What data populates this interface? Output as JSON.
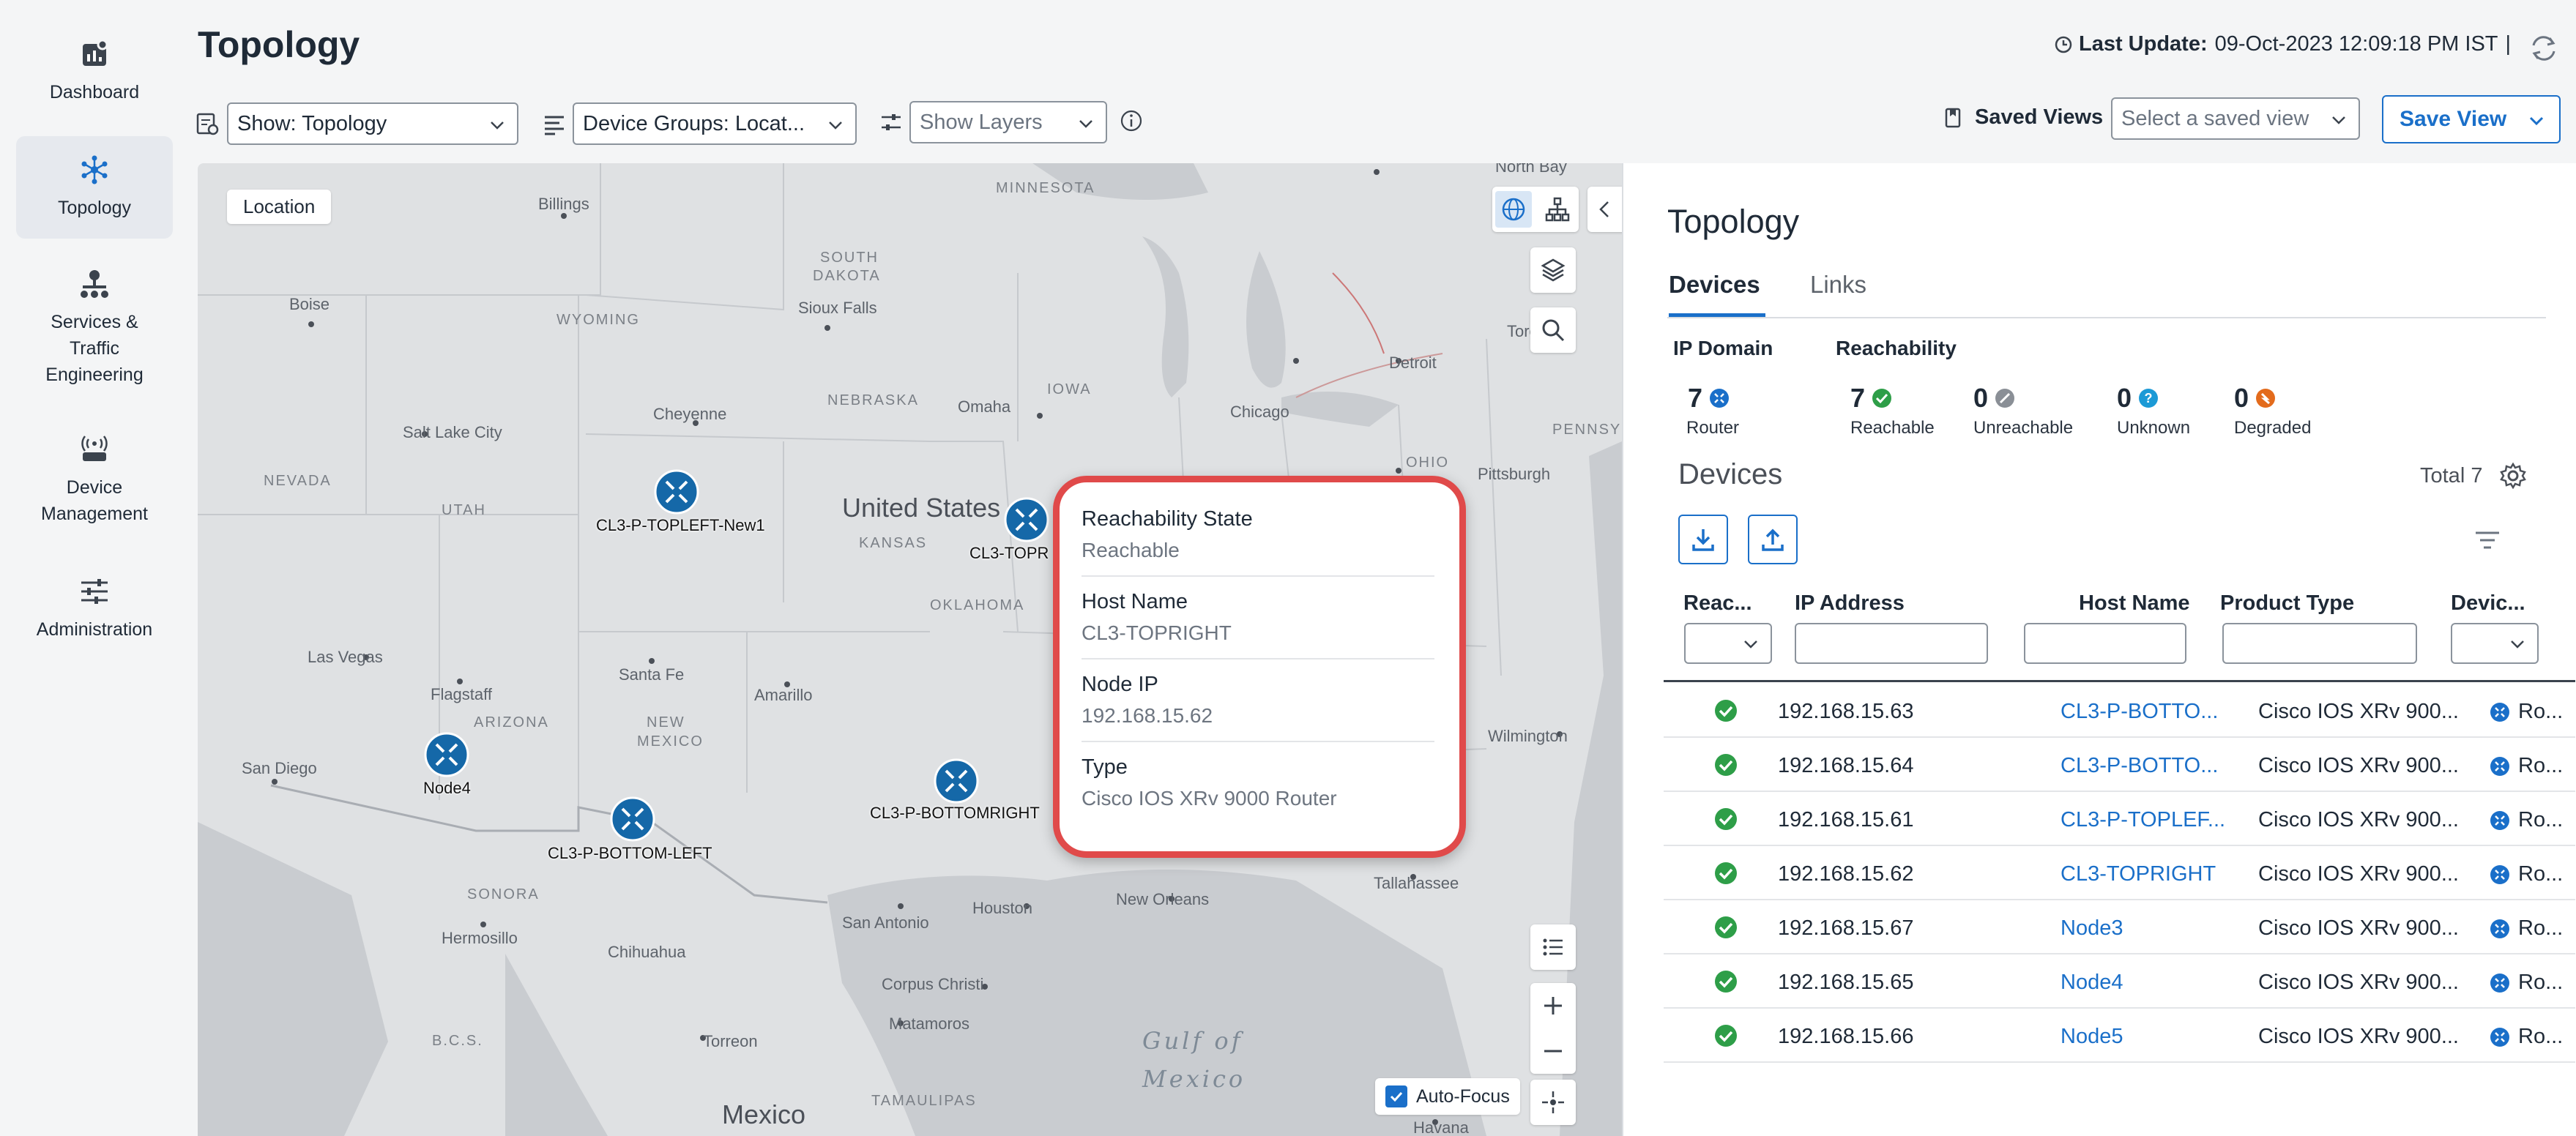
{
  "nav": {
    "items": [
      {
        "label": "Dashboard",
        "icon": "dashboard-icon",
        "active": false
      },
      {
        "label": "Topology",
        "icon": "topology-icon",
        "active": true
      },
      {
        "label": "Services & Traffic Engineering",
        "icon": "services-icon",
        "active": false
      },
      {
        "label": "Device Management",
        "icon": "device-management-icon",
        "active": false
      },
      {
        "label": "Administration",
        "icon": "administration-icon",
        "active": false
      }
    ]
  },
  "header": {
    "title": "Topology",
    "last_update_label": "Last Update:",
    "last_update_value": "09-Oct-2023 12:09:18 PM IST",
    "separator": "|"
  },
  "toolbar": {
    "show_dropdown": "Show: Topology",
    "device_groups_dropdown": "Device Groups: Locat...",
    "layers_dropdown": "Show Layers",
    "saved_views_label": "Saved Views",
    "saved_view_placeholder": "Select a saved view",
    "save_view_button": "Save View"
  },
  "map": {
    "location_chip": "Location",
    "autofocus_label": "Auto-Focus",
    "autofocus_checked": true,
    "labels": {
      "minnesota": "MINNESOTA",
      "south_dakota_1": "SOUTH",
      "south_dakota_2": "DAKOTA",
      "wyoming": "WYOMING",
      "iowa": "IOWA",
      "nebraska": "NEBRASKA",
      "kansas": "KANSAS",
      "nevada": "NEVADA",
      "utah": "UTAH",
      "arizona": "ARIZONA",
      "new_mexico_1": "NEW",
      "new_mexico_2": "MEXICO",
      "oklahoma": "OKLAHOMA",
      "ohio": "OHIO",
      "pennsylvania": "PENNSYLVANIA",
      "sonora": "SONORA",
      "chihuahua": "Chihuahua",
      "tamaulipas": "TAMAULIPAS",
      "bcs": "B.C.S.",
      "united_states": "United States",
      "mexico": "Mexico",
      "gulf_1": "Gulf of",
      "gulf_2": "Mexico"
    },
    "cities": {
      "billings": "Billings",
      "boise": "Boise",
      "sioux_falls": "Sioux Falls",
      "salt_lake": "Salt Lake City",
      "cheyenne": "Cheyenne",
      "omaha": "Omaha",
      "chicago": "Chicago",
      "detroit": "Detroit",
      "north_bay": "North Bay",
      "toronto": "Toro",
      "pittsburgh": "Pittsburgh",
      "las_vegas": "Las Vegas",
      "flagstaff": "Flagstaff",
      "santa_fe": "Santa Fe",
      "amarillo": "Amarillo",
      "san_diego": "San Diego",
      "hermosillo": "Hermosillo",
      "san_antonio": "San Antonio",
      "houston": "Houston",
      "new_orleans": "New Orleans",
      "tallahassee": "Tallahassee",
      "wilmington": "Wilmington",
      "corpus_christi": "Corpus Christi",
      "torreon": "Torreon",
      "matamoros": "Matamoros",
      "havana": "Havana"
    },
    "nodes": [
      {
        "label": "CL3-P-TOPLEFT-New1"
      },
      {
        "label": "CL3-TOPR"
      },
      {
        "label": "Node4"
      },
      {
        "label": "CL3-P-BOTTOM-LEFT"
      },
      {
        "label": "CL3-P-BOTTOMRIGHT"
      }
    ]
  },
  "tooltip": {
    "fields": [
      {
        "key": "Reachability State",
        "value": "Reachable"
      },
      {
        "key": "Host Name",
        "value": "CL3-TOPRIGHT"
      },
      {
        "key": "Node IP",
        "value": "192.168.15.62"
      },
      {
        "key": "Type",
        "value": "Cisco IOS XRv 9000 Router"
      }
    ]
  },
  "panel": {
    "title": "Topology",
    "tabs": [
      {
        "label": "Devices",
        "active": true
      },
      {
        "label": "Links",
        "active": false
      }
    ],
    "ip_domain_heading": "IP Domain",
    "reachability_heading": "Reachability",
    "stats": [
      {
        "count": "7",
        "label": "Router",
        "icon": "router-icon",
        "color": "#1a6fc9"
      },
      {
        "count": "7",
        "label": "Reachable",
        "icon": "check-circle-icon",
        "color": "#2e9e48"
      },
      {
        "count": "0",
        "label": "Unreachable",
        "icon": "unreachable-icon",
        "color": "#8a8f96"
      },
      {
        "count": "0",
        "label": "Unknown",
        "icon": "unknown-icon",
        "color": "#1c9ad6"
      },
      {
        "count": "0",
        "label": "Degraded",
        "icon": "degraded-icon",
        "color": "#e36b1c"
      }
    ],
    "devices_title": "Devices",
    "total_label": "Total 7",
    "columns": [
      "Reac...",
      "IP Address",
      "Host Name",
      "Product Type",
      "Devic..."
    ],
    "rows": [
      {
        "ip": "192.168.15.63",
        "host": "CL3-P-BOTTO...",
        "product": "Cisco IOS XRv 900...",
        "device": "Ro..."
      },
      {
        "ip": "192.168.15.64",
        "host": "CL3-P-BOTTO...",
        "product": "Cisco IOS XRv 900...",
        "device": "Ro..."
      },
      {
        "ip": "192.168.15.61",
        "host": "CL3-P-TOPLEF...",
        "product": "Cisco IOS XRv 900...",
        "device": "Ro..."
      },
      {
        "ip": "192.168.15.62",
        "host": "CL3-TOPRIGHT",
        "product": "Cisco IOS XRv 900...",
        "device": "Ro..."
      },
      {
        "ip": "192.168.15.67",
        "host": "Node3",
        "product": "Cisco IOS XRv 900...",
        "device": "Ro..."
      },
      {
        "ip": "192.168.15.65",
        "host": "Node4",
        "product": "Cisco IOS XRv 900...",
        "device": "Ro..."
      },
      {
        "ip": "192.168.15.66",
        "host": "Node5",
        "product": "Cisco IOS XRv 900...",
        "device": "Ro..."
      }
    ]
  },
  "colors": {
    "accent": "#1a6fc9",
    "reachable": "#2e9e48",
    "tooltip_border": "#e04a4a",
    "node": "#1568a8"
  }
}
